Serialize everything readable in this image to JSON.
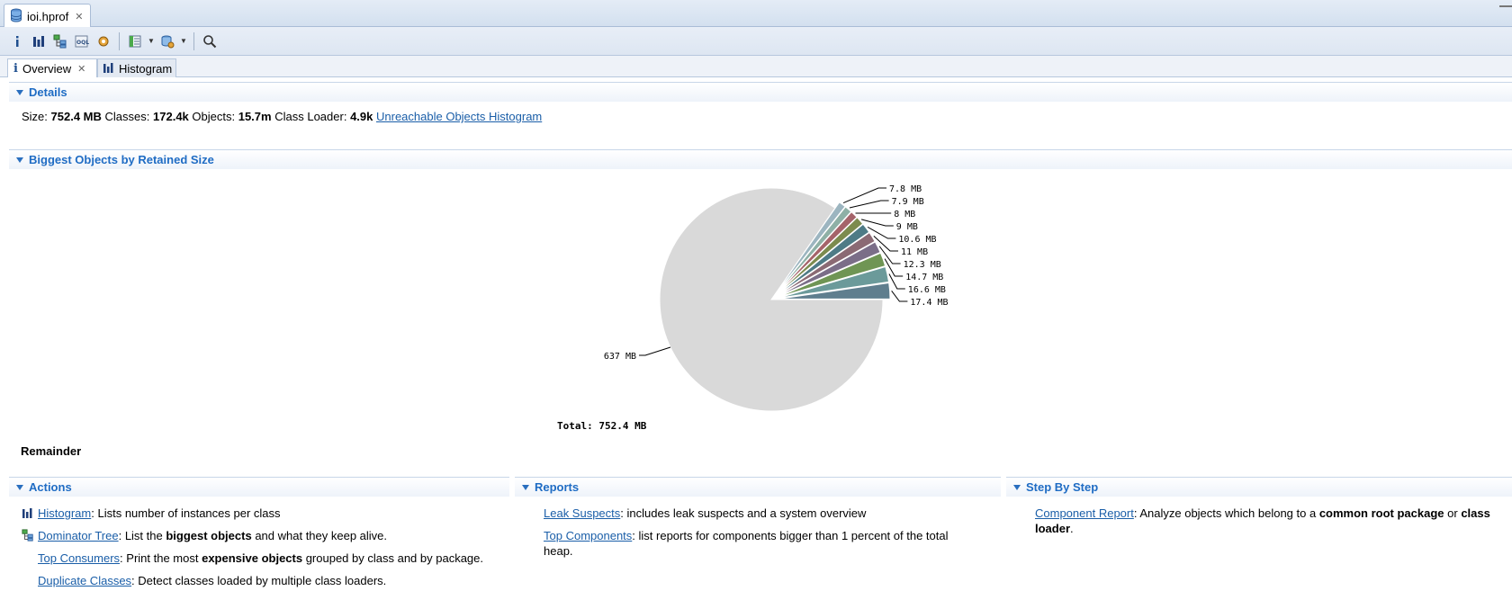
{
  "editor_tab": {
    "label": "ioi.hprof"
  },
  "toolbar": {
    "buttons": [
      "info-icon",
      "histogram-icon",
      "dominator-tree-icon",
      "oql-icon",
      "heap-dump-details-icon",
      "query-browser-icon",
      "run-report-icon",
      "search-icon"
    ]
  },
  "subtabs": {
    "overview": "Overview",
    "histogram": "Histogram"
  },
  "details": {
    "header": "Details",
    "size_label": "Size:",
    "size_value": "752.4 MB",
    "classes_label": "Classes:",
    "classes_value": "172.4k",
    "objects_label": "Objects:",
    "objects_value": "15.7m",
    "loader_label": "Class Loader:",
    "loader_value": "4.9k",
    "unreachable_link": "Unreachable Objects Histogram"
  },
  "biggest": {
    "header": "Biggest Objects by Retained Size",
    "remainder_label": "Remainder"
  },
  "chart_data": {
    "type": "pie",
    "unit": "MB",
    "slices": [
      {
        "label": "17.4 MB",
        "value": 17.4,
        "color": "#5f7e8e"
      },
      {
        "label": "16.6 MB",
        "value": 16.6,
        "color": "#6b9a9a"
      },
      {
        "label": "14.7 MB",
        "value": 14.7,
        "color": "#6f9554"
      },
      {
        "label": "12.3 MB",
        "value": 12.3,
        "color": "#7b6e88"
      },
      {
        "label": "11 MB",
        "value": 11.0,
        "color": "#8b6a74"
      },
      {
        "label": "10.6 MB",
        "value": 10.6,
        "color": "#4e7b86"
      },
      {
        "label": "9 MB",
        "value": 9.0,
        "color": "#7c8b4e"
      },
      {
        "label": "8 MB",
        "value": 8.0,
        "color": "#a5646a"
      },
      {
        "label": "7.9 MB",
        "value": 7.9,
        "color": "#8eb0a6"
      },
      {
        "label": "7.8 MB",
        "value": 7.8,
        "color": "#9cb5c0"
      },
      {
        "label": "637 MB",
        "value": 637.0,
        "color": "#d9d9d9"
      }
    ],
    "total_label": "Total: 752.4 MB"
  },
  "actions": {
    "header": "Actions",
    "items": [
      {
        "link": "Histogram",
        "text1": ": Lists number of instances per class",
        "bold": "",
        "text2": ""
      },
      {
        "link": "Dominator Tree",
        "text1": ": List the ",
        "bold": "biggest objects",
        "text2": " and what they keep alive."
      },
      {
        "link": "Top Consumers",
        "text1": ": Print the most ",
        "bold": "expensive objects",
        "text2": " grouped by class and by package."
      },
      {
        "link": "Duplicate Classes",
        "text1": ": Detect classes loaded by multiple class loaders.",
        "bold": "",
        "text2": ""
      }
    ]
  },
  "reports": {
    "header": "Reports",
    "items": [
      {
        "link": "Leak Suspects",
        "text": ": includes leak suspects and a system overview"
      },
      {
        "link": "Top Components",
        "text": ": list reports for components bigger than 1 percent of the total heap."
      }
    ]
  },
  "stepbystep": {
    "header": "Step By Step",
    "link": "Component Report",
    "text1": ": Analyze objects which belong to a ",
    "bold1": "common root package",
    "text2": " or ",
    "bold2": "class loader",
    "text3": "."
  }
}
